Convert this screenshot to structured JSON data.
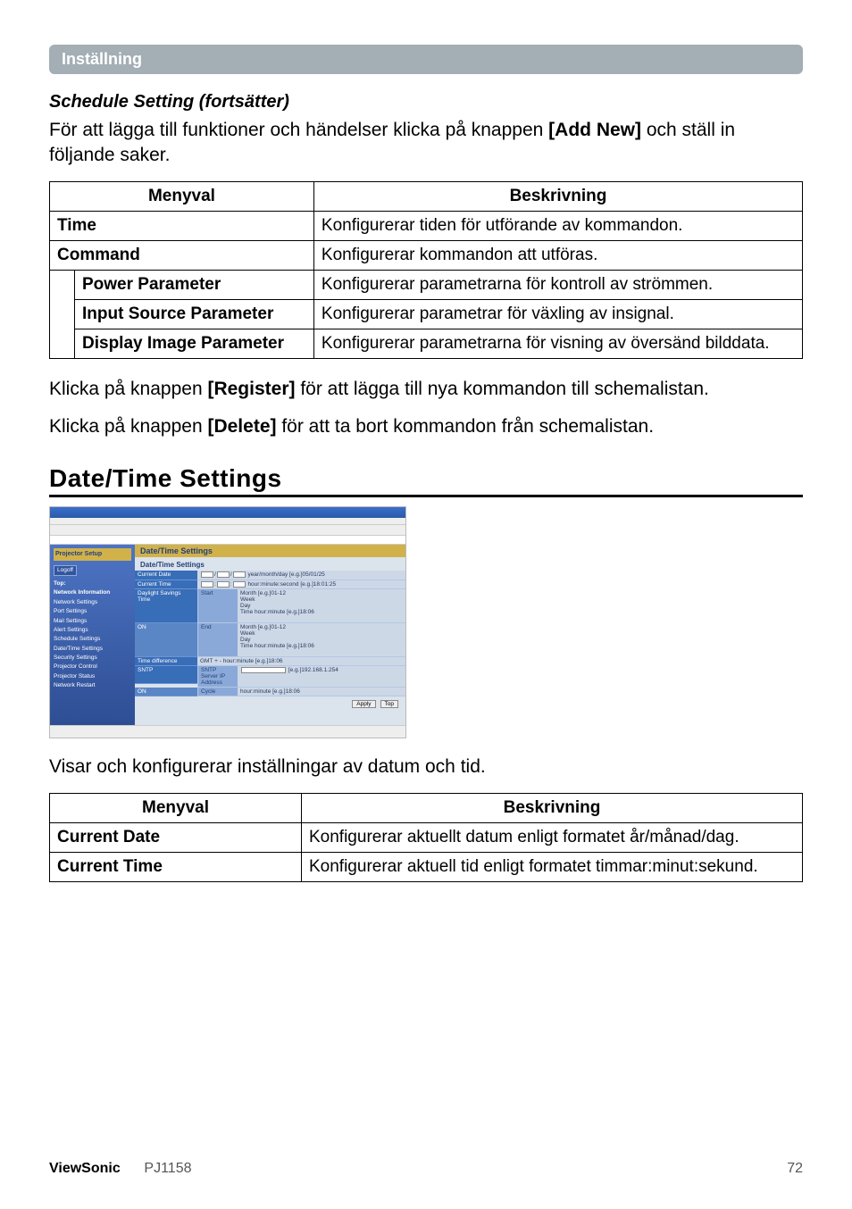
{
  "tab": "Inställning",
  "schedule": {
    "heading": "Schedule Setting (fortsätter)",
    "intro_pre": "För att lägga till funktioner och händelser klicka på knappen ",
    "intro_bold": "[Add New]",
    "intro_post": " och ställ in följande saker.",
    "headers": {
      "col1": "Menyval",
      "col2": "Beskrivning"
    },
    "rows": {
      "time": {
        "label": "Time",
        "desc": "Konfigurerar tiden för utförande av kommandon."
      },
      "command": {
        "label": "Command",
        "desc": "Konfigurerar kommandon att utföras."
      },
      "power": {
        "label": "Power Parameter",
        "desc": "Konfigurerar parametrarna för kontroll av strömmen."
      },
      "input": {
        "label": "Input Source Parameter",
        "desc": "Konfigurerar parametrar för växling av insignal."
      },
      "display": {
        "label": "Display Image Parameter",
        "desc": "Konfigurerar parametrarna för visning av översänd bilddata."
      }
    },
    "reg_pre": "Klicka på knappen ",
    "reg_bold": "[Register]",
    "reg_post": " för att lägga till nya kommandon till schemalistan.",
    "del_pre": "Klicka på knappen ",
    "del_bold": "[Delete]",
    "del_post": " för att ta bort kommandon från schemalistan."
  },
  "datetime": {
    "title": "Date/Time Settings",
    "screenshot": {
      "side_header": "Projector Setup",
      "logoff": "Logoff",
      "side_items": [
        "Top:",
        "Network Information",
        "Network Settings",
        "Port Settings",
        "Mail Settings",
        "Alert Settings",
        "Schedule Settings",
        "Date/Time Settings",
        "Security Settings",
        "Projector Control",
        "Projector Status",
        "Network Restart"
      ],
      "panel_title": "Date/Time Settings",
      "section_label": "Date/Time Settings",
      "rows": {
        "current_date": {
          "lab": "Current Date",
          "val": "year/month/day  [e.g.]05/01/25"
        },
        "current_time": {
          "lab": "Current Time",
          "val": "hour:minute:second  [e.g.]18:01:25"
        },
        "daylight": {
          "lab": "Daylight Savings Time",
          "on": "ON"
        },
        "start": {
          "lab2": "Start",
          "month": "Month  [e.g.]01-12",
          "week": "Week",
          "day": "Day",
          "time": "Time hour:minute  [e.g.]18:06"
        },
        "end": {
          "lab2": "End",
          "month": "Month  [e.g.]01-12",
          "week": "Week",
          "day": "Day",
          "time": "Time hour:minute  [e.g.]18:06"
        },
        "timediff": {
          "lab": "Time difference",
          "val": "GMT  +   -   hour:minute  [e.g.]18:06"
        },
        "sntp": {
          "lab": "SNTP",
          "on": "ON",
          "srv": "SNTP Server IP Address",
          "srv_eg": "[e.g.]192.168.1.254",
          "cycle": "Cycle",
          "cycle_val": "hour:minute  [e.g.]18:06"
        }
      },
      "apply": "Apply",
      "top": "Top"
    },
    "caption": "Visar och konfigurerar inställningar av datum och tid.",
    "headers": {
      "col1": "Menyval",
      "col2": "Beskrivning"
    },
    "rows": {
      "current_date": {
        "label": "Current Date",
        "desc": "Konfigurerar aktuellt datum enligt formatet år/månad/dag."
      },
      "current_time": {
        "label": "Current Time",
        "desc": "Konfigurerar aktuell tid enligt formatet timmar:minut:sekund."
      }
    }
  },
  "footer": {
    "brand": "ViewSonic",
    "model": "PJ1158",
    "page": "72"
  }
}
